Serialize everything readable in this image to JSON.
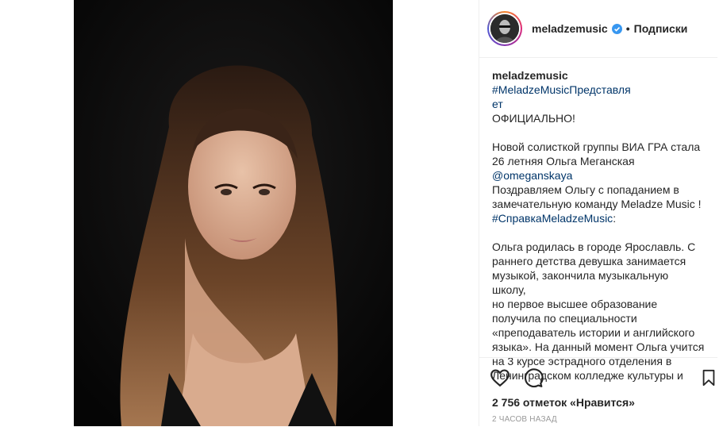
{
  "post": {
    "photo_icon": "portrait-photo",
    "header": {
      "username": "meladzemusic",
      "separator": "•",
      "follow_label": "Подписки",
      "verified_icon": "verified-badge-icon"
    },
    "caption": {
      "username": "meladzemusic",
      "hashtag1_line1": "#MeladzeMusicПредставля",
      "hashtag1_line2": "ет",
      "p1": "ОФИЦИАЛЬНО!",
      "p2a": "Новой солисткой группы ВИА ГРА стала",
      "p2b": "26 летняя Ольга Меганская",
      "mention": "@omeganskaya",
      "p3a": "Поздравляем Ольгу с попаданием в",
      "p3b": "замечательную команду Meladze Music !",
      "hashtag2": "#СправкаMeladzeMusic",
      "hashtag2_tail": ":",
      "p4": [
        "Ольга родилась в городе Ярославль. С",
        "раннего детства девушка занимается",
        "музыкой, закончила музыкальную школу,",
        "но первое высшее образование",
        "получила по специальности",
        "«преподаватель истории и английского",
        "языка». На данный момент Ольга учится",
        "на 3 курсе эстрадного отделения в",
        "Ленинградском колледже культуры и"
      ]
    },
    "actions": {
      "likes": "2 756 отметок «Нравится»",
      "time": "2 часов назад"
    }
  }
}
